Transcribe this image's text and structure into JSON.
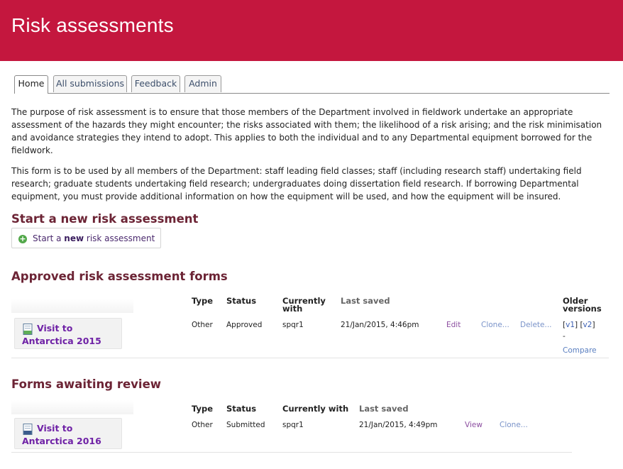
{
  "header": {
    "title": "Risk assessments"
  },
  "tabs": [
    {
      "label": "Home",
      "active": true
    },
    {
      "label": "All submissions",
      "active": false
    },
    {
      "label": "Feedback",
      "active": false
    },
    {
      "label": "Admin",
      "active": false
    }
  ],
  "intro": {
    "p1": "The purpose of risk assessment is to ensure that those members of the Department involved in fieldwork undertake an appropriate assessment of the hazards they might encounter; the risks associated with them; the likelihood of a risk arising; and the risk minimisation and avoidance strategies they intend to adopt. This applies to both the individual and to any Departmental equipment borrowed for the fieldwork.",
    "p2": "This form is to be used by all members of the Department: staff leading field classes; staff (including research staff) undertaking field research; graduate students undertaking field research; undergraduates doing dissertation field research. If borrowing Departmental equipment, you must provide additional information on how the equipment will be used, and how the equipment will be insured."
  },
  "new_section": {
    "heading": "Start a new risk assessment",
    "button_pre": "Start a ",
    "button_bold": "new",
    "button_post": " risk assessment"
  },
  "approved": {
    "heading": "Approved risk assessment forms",
    "columns": {
      "type": "Type",
      "status": "Status",
      "currently_with": "Currently with",
      "last_saved": "Last saved",
      "older_versions": "Older versions"
    },
    "row": {
      "title": "Visit to Antarctica 2015",
      "type": "Other",
      "status": "Approved",
      "currently_with": "spqr1",
      "last_saved": "21/Jan/2015, 4:46pm",
      "edit": "Edit",
      "clone": "Clone...",
      "delete": "Delete...",
      "v1": "v1",
      "v2": "v2",
      "dash": "-",
      "compare": "Compare"
    }
  },
  "review": {
    "heading": "Forms awaiting review",
    "columns": {
      "type": "Type",
      "status": "Status",
      "currently_with": "Currently with",
      "last_saved": "Last saved"
    },
    "row": {
      "title": "Visit to Antarctica 2016",
      "type": "Other",
      "status": "Submitted",
      "currently_with": "spqr1",
      "last_saved": "21/Jan/2015, 4:49pm",
      "view": "View",
      "clone": "Clone..."
    }
  },
  "colors": {
    "banner": "#c4173e",
    "heading": "#6c2435",
    "link_title": "#6f22a6"
  }
}
